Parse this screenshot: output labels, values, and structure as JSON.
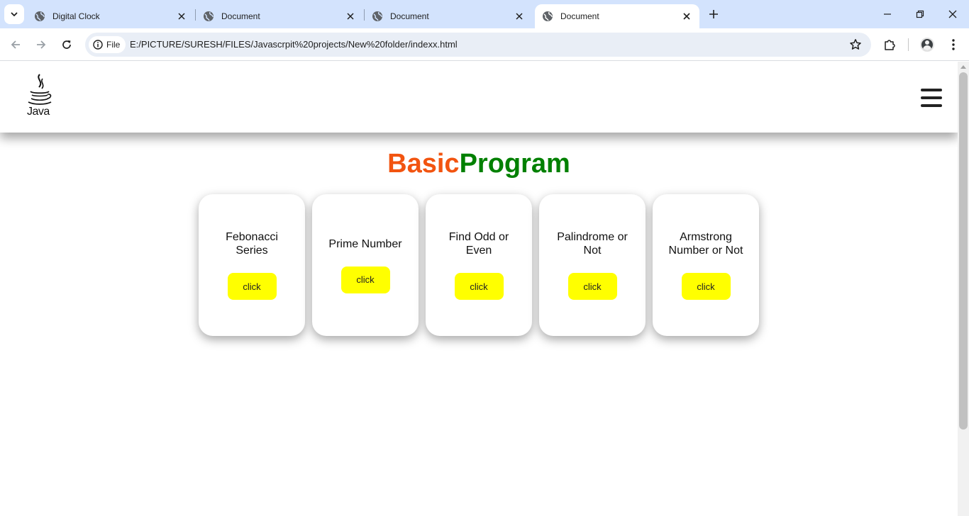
{
  "browser": {
    "tabs": [
      {
        "title": "Digital Clock",
        "active": false
      },
      {
        "title": "Document",
        "active": false
      },
      {
        "title": "Document",
        "active": false
      },
      {
        "title": "Document",
        "active": true
      }
    ],
    "chip_label": "File",
    "url": "E:/PICTURE/SURESH/FILES/Javascrpit%20projects/New%20folder/indexx.html",
    "colors": {
      "tabstrip": "#d3e3fd",
      "omnibox": "#e9eef6"
    }
  },
  "site": {
    "logo_text": "Java",
    "title_part1": "Basic",
    "title_part2": "Program",
    "colors": {
      "title_part1": "#f25410",
      "title_part2": "#008000",
      "button": "#ffff00"
    },
    "cards": [
      {
        "label": "Febonacci Series",
        "button": "click"
      },
      {
        "label": "Prime Number",
        "button": "click"
      },
      {
        "label": "Find Odd or Even",
        "button": "click"
      },
      {
        "label": "Palindrome or Not",
        "button": "click"
      },
      {
        "label": "Armstrong Number or Not",
        "button": "click"
      }
    ]
  }
}
